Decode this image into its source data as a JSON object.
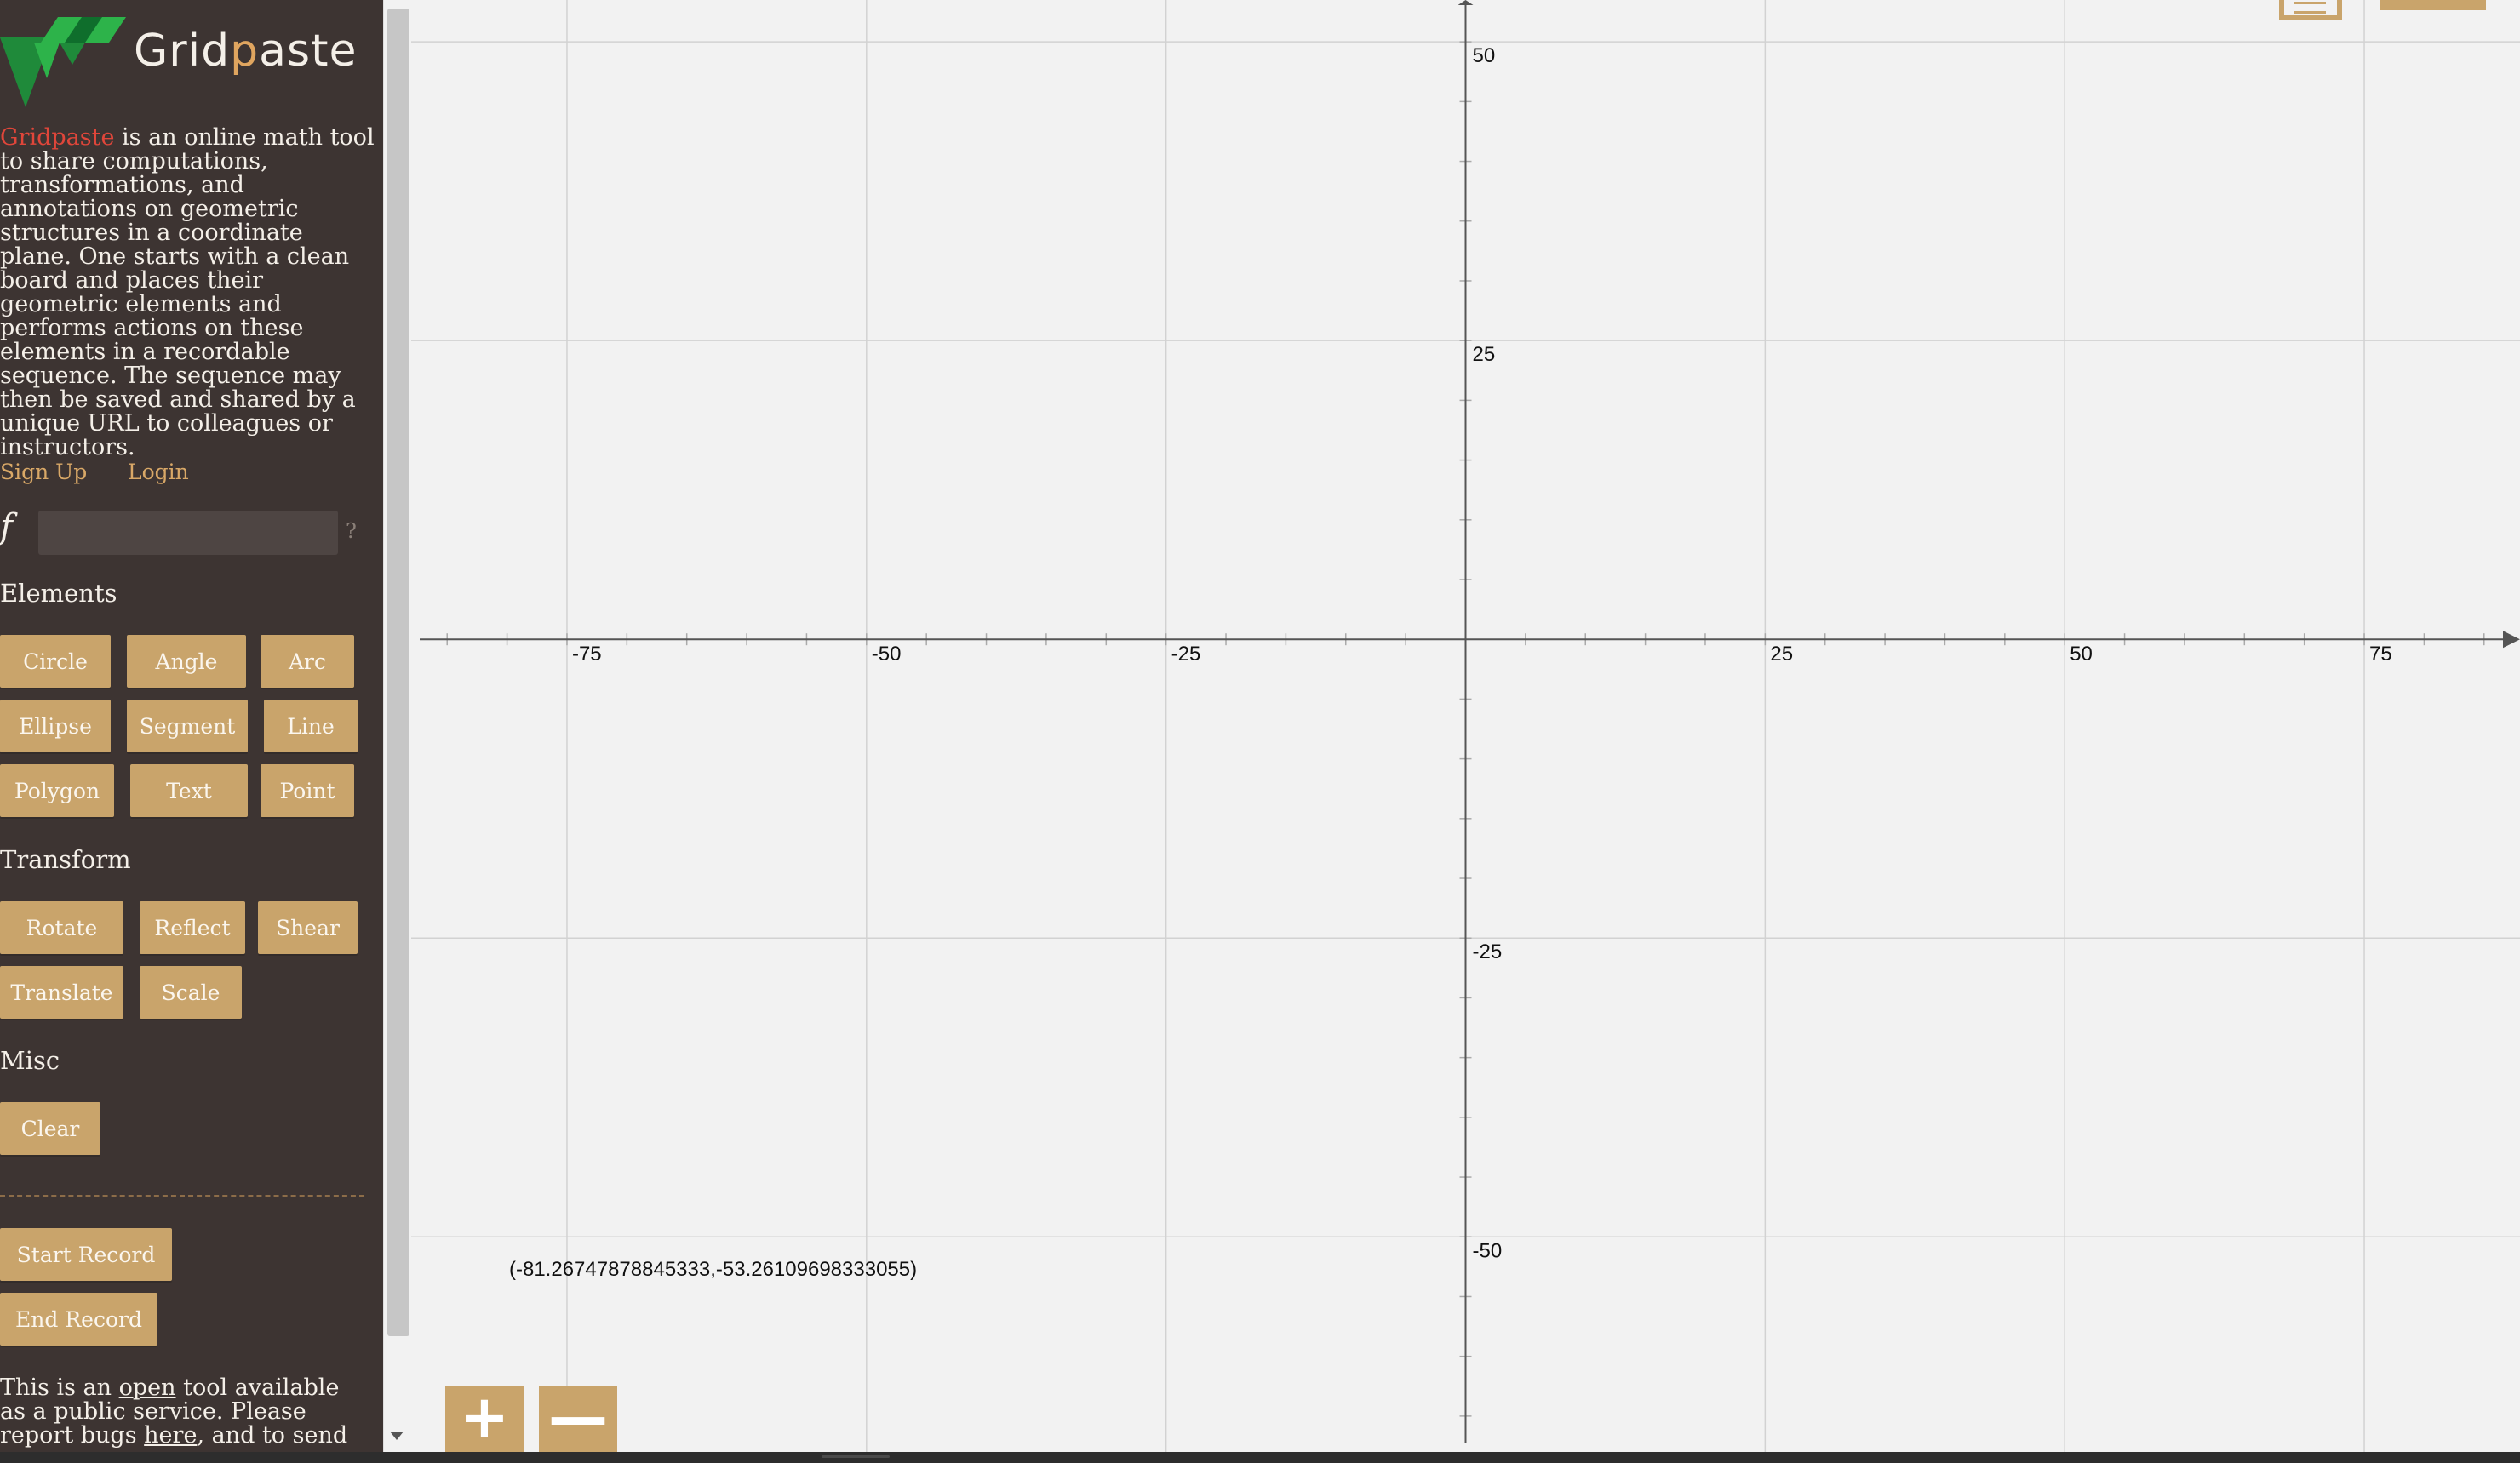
{
  "brand": {
    "prefix": "Grid",
    "highlight": "p",
    "suffix": "aste"
  },
  "intro": {
    "brand_name": "Gridpaste",
    "text": " is an online math tool to share computations, transformations, and annotations on geometric structures in a coordinate plane. One starts with a clean board and places their geometric elements and performs actions on these elements in a recordable sequence. The sequence may then be saved and shared by a unique URL to colleagues or instructors."
  },
  "auth": {
    "signup": "Sign Up",
    "login": "Login"
  },
  "formula": {
    "label": "f",
    "value": "",
    "help": "?"
  },
  "elements": {
    "title": "Elements",
    "circle": "Circle",
    "angle": "Angle",
    "arc": "Arc",
    "ellipse": "Ellipse",
    "segment": "Segment",
    "line": "Line",
    "polygon": "Polygon",
    "text": "Text",
    "point": "Point"
  },
  "transform": {
    "title": "Transform",
    "rotate": "Rotate",
    "reflect": "Reflect",
    "shear": "Shear",
    "translate": "Translate",
    "scale": "Scale"
  },
  "misc": {
    "title": "Misc",
    "clear": "Clear"
  },
  "record": {
    "start": "Start Record",
    "end": "End Record"
  },
  "footer": {
    "p1": "This is an ",
    "open_link": "open",
    "p2": " tool available as a public service. Please report bugs ",
    "here_link": "here",
    "p3": ", and to send"
  },
  "board": {
    "coordinate_readout": "(-81.26747878845333,-53.26109698333055)",
    "zoom_in": "+",
    "zoom_out": "—"
  },
  "chart_data": {
    "type": "scatter",
    "title": "",
    "xlabel": "",
    "ylabel": "",
    "xlim": [
      -88,
      88
    ],
    "ylim": [
      -68,
      53.5
    ],
    "x_ticks": [
      -75,
      -50,
      -25,
      25,
      50,
      75
    ],
    "y_ticks": [
      50,
      25,
      -25,
      -50
    ],
    "x_tick_labels": [
      "-75",
      "-50",
      "-25",
      "25",
      "50",
      "75"
    ],
    "y_tick_labels": [
      "50",
      "25",
      "-25",
      "-50"
    ],
    "grid": true,
    "series": []
  }
}
